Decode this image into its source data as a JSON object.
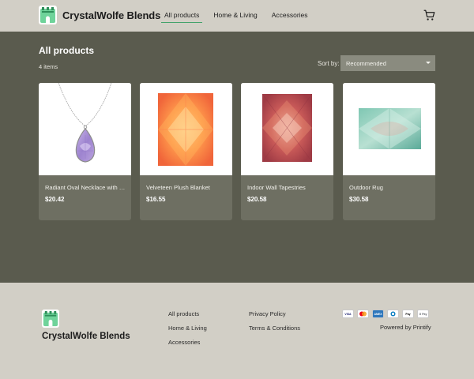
{
  "header": {
    "brand": "CrystalWolfe Blends",
    "nav": [
      "All products",
      "Home & Living",
      "Accessories"
    ],
    "active_nav": "All products",
    "cart_icon": "cart-icon"
  },
  "main": {
    "title": "All products",
    "count": "4 items",
    "sort_label": "Sort by:",
    "sort_value": "Recommended",
    "products": [
      {
        "name": "Radiant Oval Necklace with P...",
        "price": "$20.42",
        "image": "necklace"
      },
      {
        "name": "Velveteen Plush Blanket",
        "price": "$16.55",
        "image": "blanket"
      },
      {
        "name": "Indoor Wall Tapestries",
        "price": "$20.58",
        "image": "tapestry"
      },
      {
        "name": "Outdoor Rug",
        "price": "$30.58",
        "image": "rug"
      }
    ]
  },
  "footer": {
    "brand": "CrystalWolfe Blends",
    "links_col1": [
      "All products",
      "Home & Living",
      "Accessories"
    ],
    "links_col2": [
      "Privacy Policy",
      "Terms & Conditions"
    ],
    "payments": [
      "VISA",
      "MC",
      "AMEX",
      "DC",
      "Pay",
      "G Pay"
    ],
    "powered_by": "Powered by Printify"
  },
  "colors": {
    "header_bg": "#d2cfc6",
    "page_bg": "#5a5b4e",
    "card_bg": "#6e6f62",
    "accent": "#43a36b"
  }
}
